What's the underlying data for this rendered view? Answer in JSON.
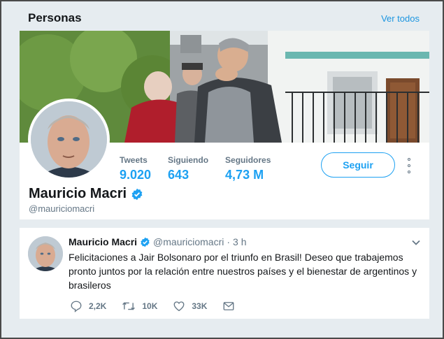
{
  "header": {
    "title": "Personas",
    "view_all": "Ver todos"
  },
  "profile": {
    "name": "Mauricio Macri",
    "handle": "@mauriciomacri",
    "follow_label": "Seguir",
    "stats": [
      {
        "label": "Tweets",
        "value": "9.020"
      },
      {
        "label": "Siguiendo",
        "value": "643"
      },
      {
        "label": "Seguidores",
        "value": "4,73 M"
      }
    ]
  },
  "tweet": {
    "name": "Mauricio Macri",
    "handle": "@mauriciomacri",
    "separator": "·",
    "time": "3 h",
    "text": "Felicitaciones a Jair Bolsonaro por el triunfo en Brasil! Deseo que trabajemos pronto juntos por la relación entre nuestros países y el bienestar de argentinos y brasileros",
    "actions": {
      "replies": "2,2K",
      "retweets": "10K",
      "likes": "33K"
    }
  },
  "colors": {
    "accent": "#1da1f2",
    "link": "#1b95e0",
    "muted": "#657786",
    "background": "#e6ecf0"
  },
  "icons": [
    "verified-icon",
    "chevron-down-icon",
    "reply-icon",
    "retweet-icon",
    "like-icon",
    "message-icon",
    "more-icon"
  ]
}
